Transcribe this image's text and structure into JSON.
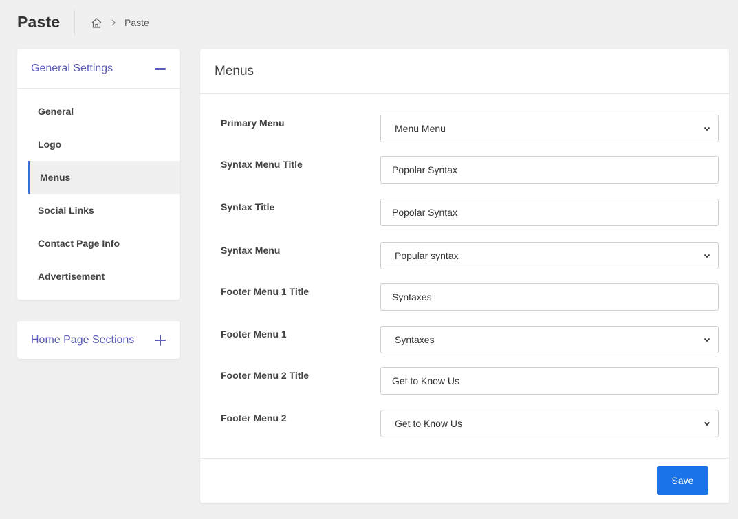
{
  "header": {
    "title": "Paste",
    "breadcrumb": {
      "current": "Paste"
    }
  },
  "sidebar": {
    "general": {
      "title": "General Settings",
      "items": [
        {
          "label": "General"
        },
        {
          "label": "Logo"
        },
        {
          "label": "Menus"
        },
        {
          "label": "Social Links"
        },
        {
          "label": "Contact Page Info"
        },
        {
          "label": "Advertisement"
        }
      ]
    },
    "home": {
      "title": "Home Page Sections"
    }
  },
  "main": {
    "title": "Menus",
    "fields": {
      "primary_menu": {
        "label": "Primary Menu",
        "value": "Menu Menu"
      },
      "syntax_menu_title": {
        "label": "Syntax Menu Title",
        "value": "Popolar Syntax"
      },
      "syntax_title": {
        "label": "Syntax Title",
        "value": "Popolar Syntax"
      },
      "syntax_menu": {
        "label": "Syntax Menu",
        "value": "Popular syntax"
      },
      "footer_menu_1_title": {
        "label": "Footer Menu 1 Title",
        "value": "Syntaxes"
      },
      "footer_menu_1": {
        "label": "Footer Menu 1",
        "value": "Syntaxes"
      },
      "footer_menu_2_title": {
        "label": "Footer Menu 2 Title",
        "value": "Get to Know Us"
      },
      "footer_menu_2": {
        "label": "Footer Menu 2",
        "value": "Get to Know Us"
      }
    },
    "save_label": "Save"
  },
  "colors": {
    "accent": "#5b5bb8",
    "primary_button": "#1a73e8",
    "active_indicator": "#3a6fd8",
    "background": "#f0f0f0"
  }
}
